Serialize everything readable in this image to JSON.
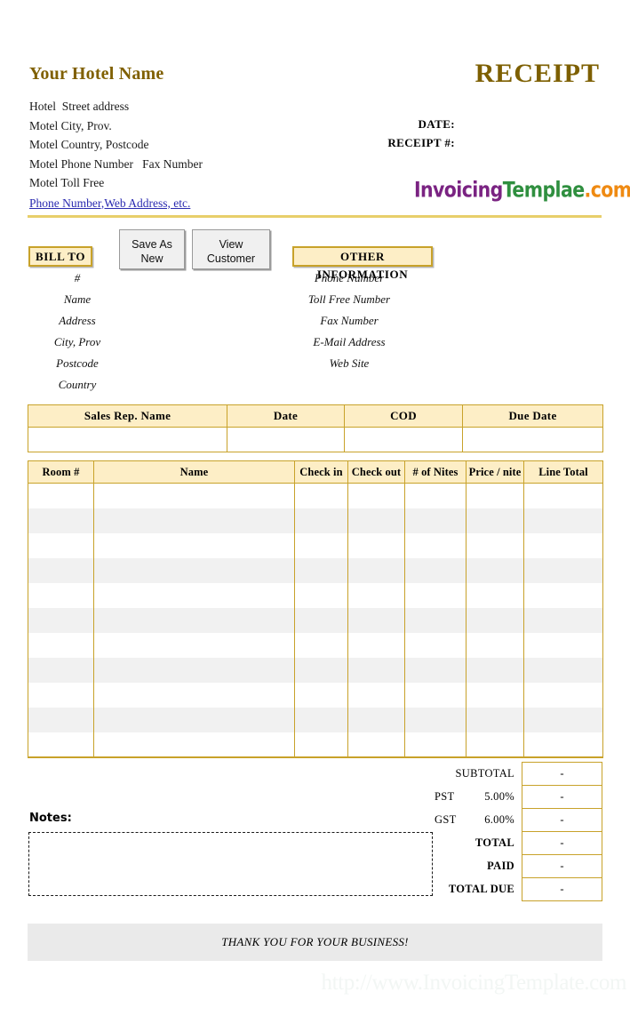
{
  "header": {
    "hotel_name": "Your Hotel Name",
    "address_lines": [
      "Hotel  Street address",
      "Motel City, Prov.",
      "Motel Country, Postcode",
      "Motel Phone Number   Fax Number",
      "Motel Toll Free"
    ],
    "contact_link": "Phone Number,Web Address, etc.",
    "title": "RECEIPT",
    "date_label": "DATE:",
    "receipt_no_label": "RECEIPT #:",
    "logo": {
      "part1": "Invoicing",
      "part2": "Templae",
      "part3": ".com",
      "color1": "#7a2382",
      "color2": "#2f8f3f",
      "color3": "#ef8a12"
    }
  },
  "bill_to": {
    "tag": "BILL TO",
    "fields": [
      "#",
      "Name",
      "Address",
      "City, Prov",
      "Postcode",
      "Country"
    ]
  },
  "other_information": {
    "tag": "OTHER INFORMATION",
    "fields": [
      "Phone Number",
      "Toll Free Number",
      "Fax Number",
      "E-Mail Address",
      "Web Site"
    ]
  },
  "buttons": {
    "save_as_new": "Save As\nNew",
    "save_as_new_line1": "Save As",
    "save_as_new_line2": "New",
    "view_customer_line1": "View",
    "view_customer_line2": "Customer"
  },
  "sales_rep_table": {
    "headers": [
      "Sales Rep. Name",
      "Date",
      "COD",
      "Due Date"
    ],
    "values": [
      "",
      "",
      "",
      ""
    ]
  },
  "items_table": {
    "headers": [
      "Room #",
      "Name",
      "Check in",
      "Check out",
      "# of Nites",
      "Price / nite",
      "Line Total"
    ],
    "row_count": 11,
    "rows": []
  },
  "totals": [
    {
      "label": "SUBTOTAL",
      "rate": "",
      "value": "-",
      "bold": false
    },
    {
      "label": "PST",
      "rate": "5.00%",
      "value": "-",
      "bold": false
    },
    {
      "label": "GST",
      "rate": "6.00%",
      "value": "-",
      "bold": false
    },
    {
      "label": "TOTAL",
      "rate": "",
      "value": "-",
      "bold": true
    },
    {
      "label": "PAID",
      "rate": "",
      "value": "-",
      "bold": true
    },
    {
      "label": "TOTAL DUE",
      "rate": "",
      "value": "-",
      "bold": true
    }
  ],
  "notes": {
    "label": "Notes:",
    "value": ""
  },
  "footer": {
    "thank_you": "THANK YOU FOR YOUR BUSINESS!",
    "watermark": "http://www.InvoicingTemplate.com"
  },
  "colors": {
    "gold_border": "#c8a22a",
    "header_fill": "#fdeec6",
    "title_gold": "#7d5f00",
    "row_stripe": "#f1f1f1",
    "footer_bg": "#eaeaea",
    "link_blue": "#2a2ab0"
  }
}
